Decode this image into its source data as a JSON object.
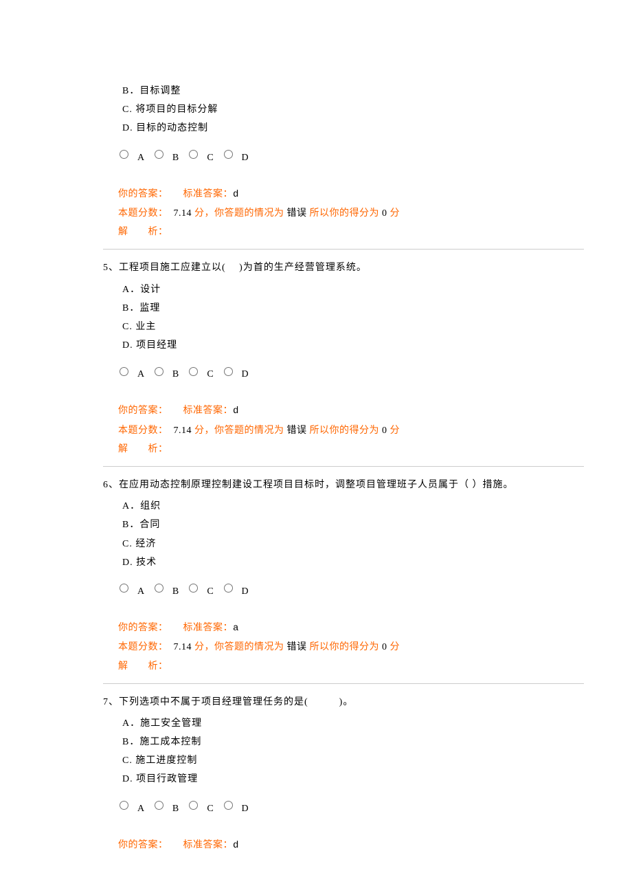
{
  "labels": {
    "your_answer": "你的答案：",
    "std_answer": "标准答案：",
    "score_prefix": "本题分数：",
    "score_val": "7.14",
    "fen": "分",
    "situation_prefix": "，你答题的情况为",
    "wrong": "错误",
    "so_score": "所以你的得分为",
    "zero": "0",
    "analysis": "解　　析："
  },
  "radio_labels": [
    "A",
    "B",
    "C",
    "D"
  ],
  "q4_partial": {
    "options": [
      "B．目标调整",
      "C. 将项目的目标分解",
      "D. 目标的动态控制"
    ],
    "std_answer": "d"
  },
  "q5": {
    "stem": "5、工程项目施工应建立以(　 )为首的生产经营管理系统。",
    "options": [
      "A．设计",
      "B．监理",
      "C. 业主",
      "D. 项目经理"
    ],
    "std_answer": "d"
  },
  "q6": {
    "stem": "6、在应用动态控制原理控制建设工程项目目标时，调整项目管理班子人员属于（ ）措施。",
    "options": [
      "A．组织",
      "B．合同",
      "C. 经济",
      "D. 技术"
    ],
    "std_answer": "a"
  },
  "q7": {
    "stem": "7、下列选项中不属于项目经理管理任务的是(　　　)。",
    "options": [
      "A．施工安全管理",
      "B．施工成本控制",
      "C. 施工进度控制",
      "D. 项目行政管理"
    ],
    "std_answer": "d"
  }
}
